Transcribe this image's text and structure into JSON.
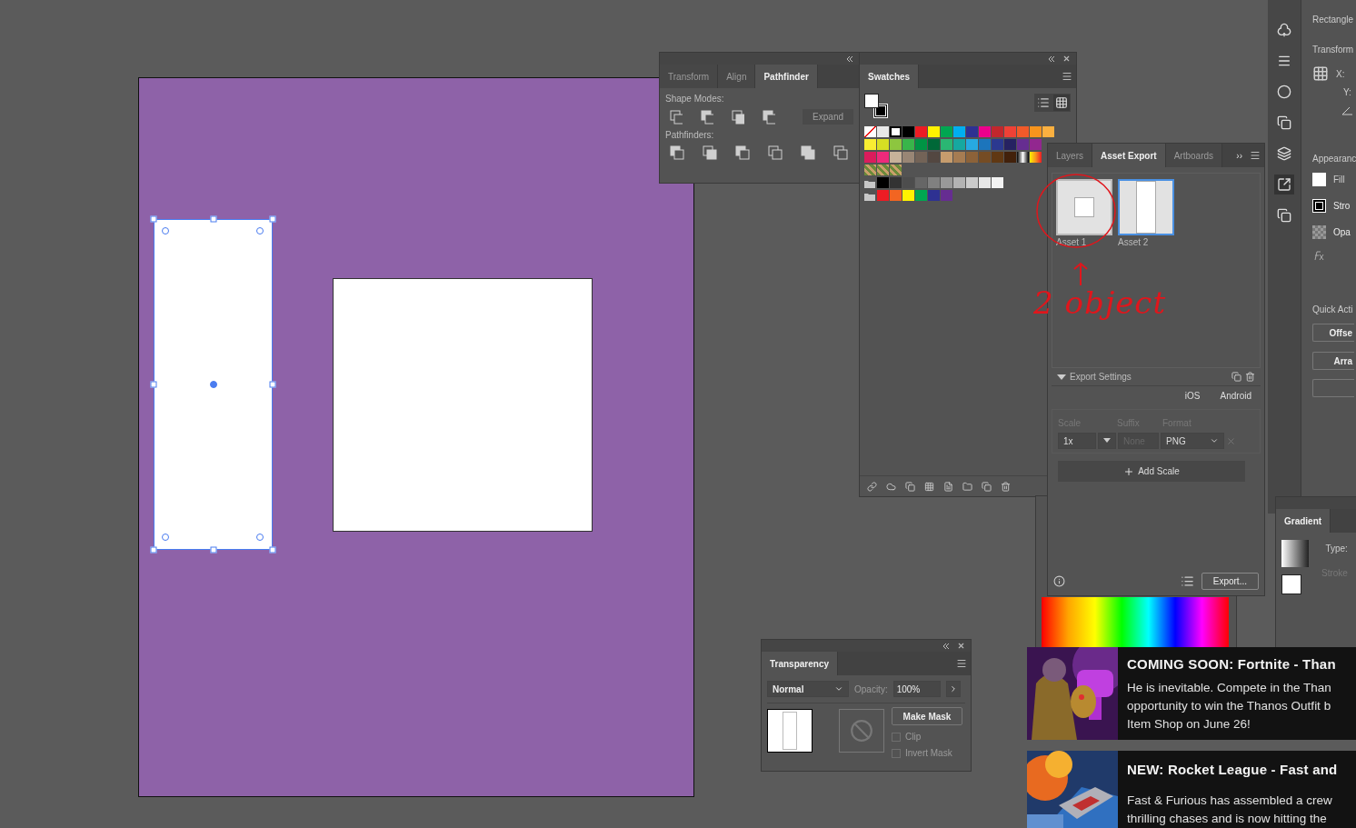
{
  "artboard": {
    "shapes": [
      {
        "selected": true
      },
      {
        "selected": false
      }
    ]
  },
  "pathfinder_panel": {
    "tabs": [
      {
        "label": "Transform",
        "selected": false
      },
      {
        "label": "Align",
        "selected": false
      },
      {
        "label": "Pathfinder",
        "selected": true
      }
    ],
    "shape_modes_label": "Shape Modes:",
    "expand_button": {
      "label": "Expand",
      "disabled": true
    },
    "pathfinders_label": "Pathfinders:"
  },
  "swatches_panel": {
    "tab": {
      "label": "Swatches",
      "selected": true
    },
    "rows": [
      {
        "folder": false,
        "swatches": [
          {
            "kind": "none"
          },
          {
            "kind": "registration"
          },
          {
            "kind": "color",
            "color": "#ffffff"
          },
          {
            "kind": "color",
            "color": "#000000"
          },
          {
            "kind": "color",
            "color": "#ed1c24"
          },
          {
            "kind": "color",
            "color": "#fff200"
          },
          {
            "kind": "color",
            "color": "#00a651"
          },
          {
            "kind": "color",
            "color": "#00aeef"
          },
          {
            "kind": "color",
            "color": "#2e3192"
          },
          {
            "kind": "color",
            "color": "#ec008c"
          },
          {
            "kind": "color",
            "color": "#c1272d"
          },
          {
            "kind": "color",
            "color": "#ef4136"
          },
          {
            "kind": "color",
            "color": "#f15a29"
          },
          {
            "kind": "color",
            "color": "#f7941d"
          },
          {
            "kind": "color",
            "color": "#fbb040"
          }
        ]
      },
      {
        "folder": false,
        "swatches": [
          {
            "kind": "color",
            "color": "#f9ed32"
          },
          {
            "kind": "color",
            "color": "#d7df23"
          },
          {
            "kind": "color",
            "color": "#8dc63f"
          },
          {
            "kind": "color",
            "color": "#39b54a"
          },
          {
            "kind": "color",
            "color": "#009444"
          },
          {
            "kind": "color",
            "color": "#006838"
          },
          {
            "kind": "color",
            "color": "#2bb673"
          },
          {
            "kind": "color",
            "color": "#16a8a0"
          },
          {
            "kind": "color",
            "color": "#27aae1"
          },
          {
            "kind": "color",
            "color": "#1c75bc"
          },
          {
            "kind": "color",
            "color": "#2b3990"
          },
          {
            "kind": "color",
            "color": "#262262"
          },
          {
            "kind": "color",
            "color": "#662d91"
          },
          {
            "kind": "color",
            "color": "#92278f"
          }
        ]
      },
      {
        "folder": false,
        "swatches": [
          {
            "kind": "color",
            "color": "#da1c5c"
          },
          {
            "kind": "color",
            "color": "#ee2a7b"
          },
          {
            "kind": "color",
            "color": "#c7b299"
          },
          {
            "kind": "color",
            "color": "#998675"
          },
          {
            "kind": "color",
            "color": "#736357"
          },
          {
            "kind": "color",
            "color": "#534741"
          },
          {
            "kind": "color",
            "color": "#c69c6d"
          },
          {
            "kind": "color",
            "color": "#a67c52"
          },
          {
            "kind": "color",
            "color": "#8c6239"
          },
          {
            "kind": "color",
            "color": "#754c24"
          },
          {
            "kind": "color",
            "color": "#603813"
          },
          {
            "kind": "color",
            "color": "#42210b"
          },
          {
            "kind": "gradient"
          },
          {
            "kind": "gradient_warm"
          }
        ]
      },
      {
        "folder": false,
        "swatches": [
          {
            "kind": "pattern"
          },
          {
            "kind": "pattern"
          },
          {
            "kind": "pattern"
          }
        ]
      },
      {
        "folder": true,
        "swatches": [
          {
            "kind": "color",
            "color": "#000000"
          },
          {
            "kind": "color",
            "color": "#333333"
          },
          {
            "kind": "color",
            "color": "#4d4d4d"
          },
          {
            "kind": "color",
            "color": "#666666"
          },
          {
            "kind": "color",
            "color": "#808080"
          },
          {
            "kind": "color",
            "color": "#999999"
          },
          {
            "kind": "color",
            "color": "#b3b3b3"
          },
          {
            "kind": "color",
            "color": "#cccccc"
          },
          {
            "kind": "color",
            "color": "#e6e6e6"
          },
          {
            "kind": "color",
            "color": "#f2f2f2"
          }
        ]
      },
      {
        "folder": true,
        "swatches": [
          {
            "kind": "color",
            "color": "#ed1c24"
          },
          {
            "kind": "color",
            "color": "#f26522"
          },
          {
            "kind": "color",
            "color": "#fff200"
          },
          {
            "kind": "color",
            "color": "#00a651"
          },
          {
            "kind": "color",
            "color": "#2e3192"
          },
          {
            "kind": "color",
            "color": "#662d91"
          }
        ]
      }
    ]
  },
  "asset_export_panel": {
    "tabs": [
      {
        "label": "Layers",
        "selected": false
      },
      {
        "label": "Asset Export",
        "selected": true
      },
      {
        "label": "Artboards",
        "selected": false
      }
    ],
    "overflow": "››",
    "assets": [
      {
        "label": "Asset 1",
        "selected": false
      },
      {
        "label": "Asset 2",
        "selected": true
      }
    ],
    "annotation": {
      "text": "2 object"
    },
    "export_settings": {
      "label": "Export Settings",
      "expanded": true
    },
    "platforms": [
      "iOS",
      "Android"
    ],
    "columns": [
      "Scale",
      "Suffix",
      "Format"
    ],
    "scale_row": {
      "scale": "1x",
      "suffix_placeholder": "None",
      "format": "PNG"
    },
    "add_scale": "Add Scale",
    "export_button": "Export..."
  },
  "properties_panel": {
    "title": "Rectangle",
    "transform_label": "Transform",
    "x_label": "X:",
    "y_label": "Y:",
    "appearance_label": "Appearanc",
    "fill_label": "Fill",
    "stroke_label": "Stro",
    "opacity_label": "Opa",
    "quick_actions_label": "Quick Acti",
    "buttons": [
      "Offse",
      "Arra"
    ]
  },
  "gradient_panel": {
    "tab": "Gradient",
    "type_label": "Type:",
    "stroke_label": "Stroke"
  },
  "transparency_panel": {
    "tab": "Transparency",
    "blend_mode": "Normal",
    "opacity_label": "Opacity:",
    "opacity": "100%",
    "make_mask": "Make Mask",
    "options": [
      {
        "label": "Clip",
        "checked": false,
        "disabled": true
      },
      {
        "label": "Invert Mask",
        "checked": false,
        "disabled": true
      }
    ]
  },
  "notifications": [
    {
      "title": "COMING SOON: Fortnite - Than",
      "lines": [
        "He is inevitable. Compete in the Than",
        "opportunity to win the Thanos Outfit b",
        "Item Shop on June 26!"
      ]
    },
    {
      "title": "NEW: Rocket League - Fast and",
      "lines": [
        "Fast & Furious has assembled a crew",
        "thrilling chases and is now hitting the"
      ]
    }
  ]
}
